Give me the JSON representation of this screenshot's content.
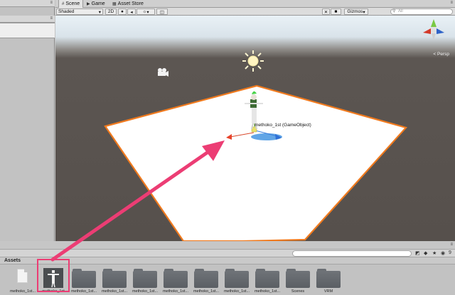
{
  "left_panel": {
    "lock_label": "≡",
    "lock_label_2": "≡"
  },
  "scene_window": {
    "tabs": [
      {
        "icon": "#",
        "label": "Scene",
        "active": true
      },
      {
        "icon": "▶",
        "label": "Game",
        "active": false
      },
      {
        "icon": "▦",
        "label": "Asset Store",
        "active": false
      }
    ],
    "menu_label": "≡",
    "toolbar": {
      "shading_mode": "Shaded",
      "two_d_label": "2D",
      "fx_label": "☼",
      "gizmos_label": "Gizmos",
      "search_placeholder": "All"
    },
    "persp_label": "< Persp",
    "selected_object_label": "methoko_1st (GameObject)"
  },
  "assets_panel": {
    "header": "Assets",
    "count_label": "9",
    "items": [
      {
        "name": "methoko_1st...",
        "kind": "file"
      },
      {
        "name": "methoko_1st",
        "kind": "model"
      },
      {
        "name": "methoko_1st...",
        "kind": "folder"
      },
      {
        "name": "methoko_1st...",
        "kind": "folder"
      },
      {
        "name": "methoko_1st...",
        "kind": "folder"
      },
      {
        "name": "methoko_1st...",
        "kind": "folder"
      },
      {
        "name": "methoko_1st...",
        "kind": "folder"
      },
      {
        "name": "methoko_1st...",
        "kind": "folder"
      },
      {
        "name": "methoko_1st...",
        "kind": "folder"
      },
      {
        "name": "Scenes",
        "kind": "folder"
      },
      {
        "name": "VRM",
        "kind": "folder"
      }
    ]
  },
  "colors": {
    "highlight": "#ec3d74",
    "plane_outline": "#f07a1e",
    "ground": "#56504c"
  }
}
